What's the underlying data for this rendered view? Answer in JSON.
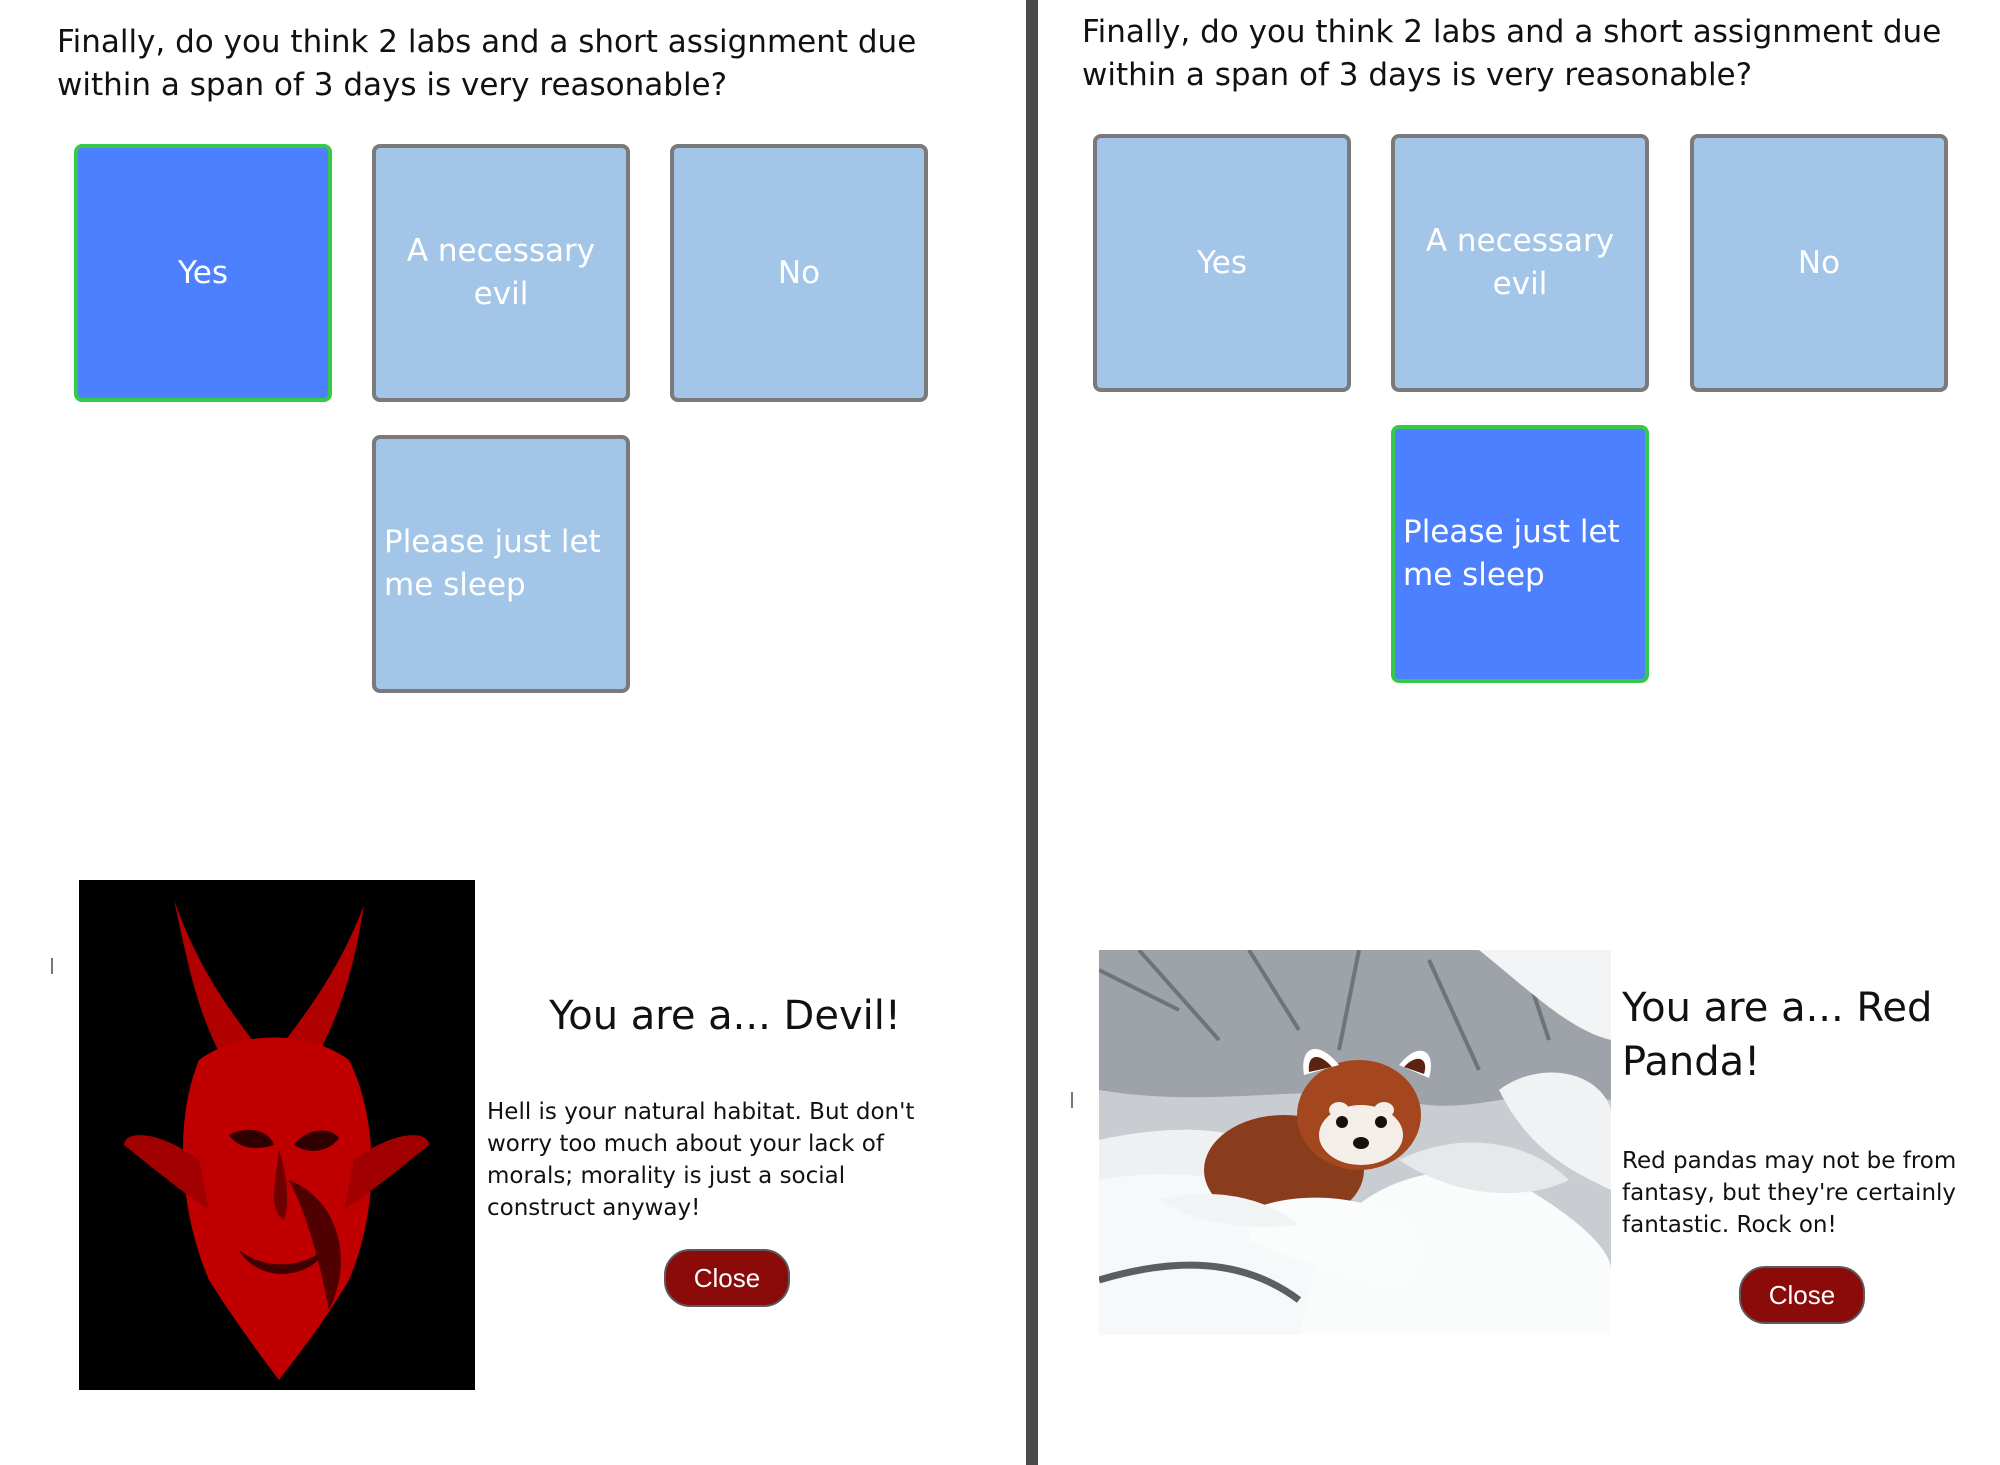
{
  "left_panel": {
    "question": "Finally, do you think 2 labs and a short assignment due within a span of 3 days is very reasonable?",
    "choices": [
      "Yes",
      "A necessary evil",
      "No",
      "Please just let me sleep"
    ],
    "selected_choice": "Yes",
    "result": {
      "image_icon": "devil-image",
      "title": "You are a... Devil!",
      "description": "Hell is your natural habitat. But don't worry too much about your lack of morals; morality is just a social construct anyway!",
      "close_label": "Close"
    }
  },
  "right_panel": {
    "question": "Finally, do you think 2 labs and a short assignment due within a span of 3 days is very reasonable?",
    "choices": [
      "Yes",
      "A necessary evil",
      "No",
      "Please just let me sleep"
    ],
    "selected_choice": "Please just let me sleep",
    "result": {
      "image_icon": "red-panda-image",
      "title": "You are a... Red Panda!",
      "description": "Red pandas may not be from fantasy, but they're certainly fantastic. Rock on!",
      "close_label": "Close"
    }
  },
  "colors": {
    "choice_default": "#a3c5e8",
    "choice_selected": "#4d80ff",
    "selected_border": "#35c94a",
    "close_button": "#8b0a0a",
    "divider": "#4a4a4a"
  }
}
